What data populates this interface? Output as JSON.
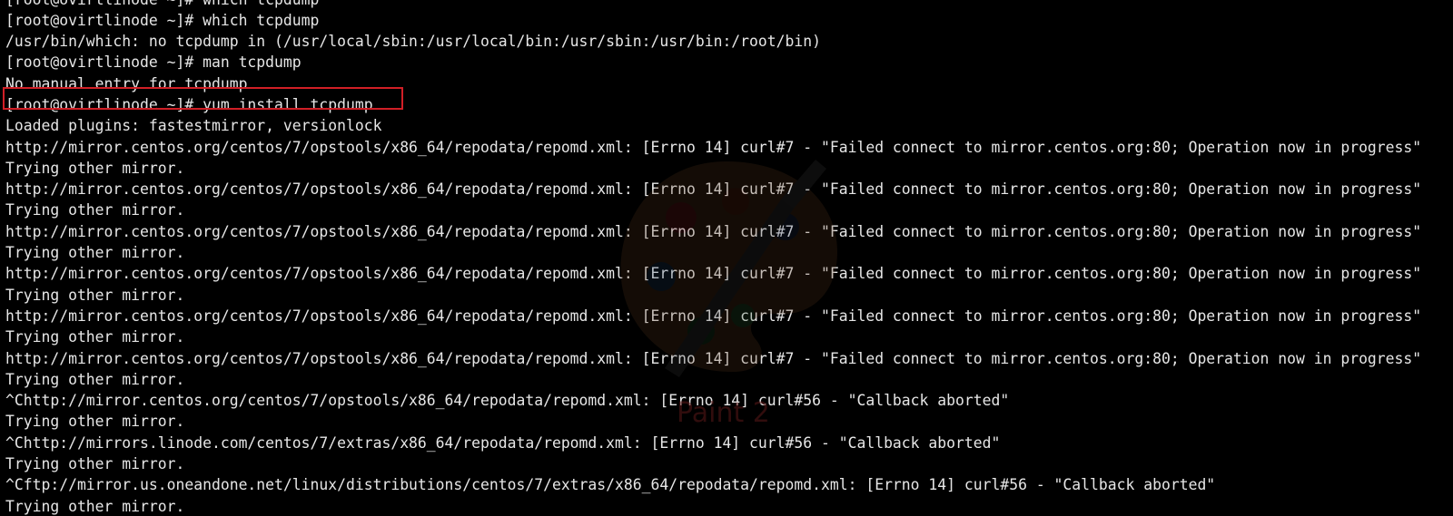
{
  "terminal": {
    "lines": [
      "[root@ovirtlinode ~]# which tcpdump",
      "[root@ovirtlinode ~]# which tcpdump",
      "/usr/bin/which: no tcpdump in (/usr/local/sbin:/usr/local/bin:/usr/sbin:/usr/bin:/root/bin)",
      "[root@ovirtlinode ~]# man tcpdump",
      "No manual entry for tcpdump",
      "[root@ovirtlinode ~]# yum install tcpdump",
      "Loaded plugins: fastestmirror, versionlock",
      "http://mirror.centos.org/centos/7/opstools/x86_64/repodata/repomd.xml: [Errno 14] curl#7 - \"Failed connect to mirror.centos.org:80; Operation now in progress\"",
      "Trying other mirror.",
      "http://mirror.centos.org/centos/7/opstools/x86_64/repodata/repomd.xml: [Errno 14] curl#7 - \"Failed connect to mirror.centos.org:80; Operation now in progress\"",
      "Trying other mirror.",
      "http://mirror.centos.org/centos/7/opstools/x86_64/repodata/repomd.xml: [Errno 14] curl#7 - \"Failed connect to mirror.centos.org:80; Operation now in progress\"",
      "Trying other mirror.",
      "http://mirror.centos.org/centos/7/opstools/x86_64/repodata/repomd.xml: [Errno 14] curl#7 - \"Failed connect to mirror.centos.org:80; Operation now in progress\"",
      "Trying other mirror.",
      "http://mirror.centos.org/centos/7/opstools/x86_64/repodata/repomd.xml: [Errno 14] curl#7 - \"Failed connect to mirror.centos.org:80; Operation now in progress\"",
      "Trying other mirror.",
      "http://mirror.centos.org/centos/7/opstools/x86_64/repodata/repomd.xml: [Errno 14] curl#7 - \"Failed connect to mirror.centos.org:80; Operation now in progress\"",
      "Trying other mirror.",
      "^Chttp://mirror.centos.org/centos/7/opstools/x86_64/repodata/repomd.xml: [Errno 14] curl#56 - \"Callback aborted\"",
      "Trying other mirror.",
      "^Chttp://mirrors.linode.com/centos/7/extras/x86_64/repodata/repomd.xml: [Errno 14] curl#56 - \"Callback aborted\"",
      "Trying other mirror.",
      "^Cftp://mirror.us.oneandone.net/linux/distributions/centos/7/extras/x86_64/repodata/repomd.xml: [Errno 14] curl#56 - \"Callback aborted\"",
      "Trying other mirror."
    ]
  },
  "watermark": {
    "text": "Paint 2"
  },
  "colors": {
    "background": "#000000",
    "foreground": "#e6e6e6",
    "highlight_border": "#d11f26"
  }
}
